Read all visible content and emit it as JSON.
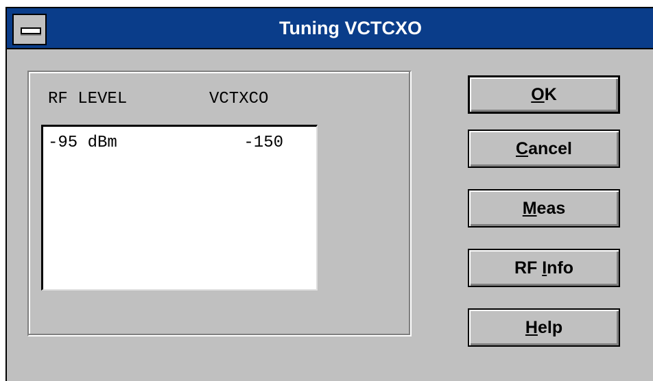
{
  "window": {
    "title": "Tuning VCTCXO"
  },
  "list": {
    "headers": {
      "rf_level": "RF LEVEL",
      "vctxco": "VCTXCO"
    },
    "rows": [
      {
        "rf_level": "-95 dBm",
        "vctxco": "-150"
      }
    ]
  },
  "buttons": {
    "ok": {
      "mnemonic": "O",
      "rest": "K"
    },
    "cancel": {
      "mnemonic": "C",
      "rest": "ancel"
    },
    "meas": {
      "mnemonic": "M",
      "rest": "eas"
    },
    "rfinfo": {
      "pre": "RF ",
      "mnemonic": "I",
      "rest": "nfo"
    },
    "help": {
      "mnemonic": "H",
      "rest": "elp"
    }
  },
  "colors": {
    "titlebar": "#0a3d8a",
    "face": "#c0c0c0"
  }
}
